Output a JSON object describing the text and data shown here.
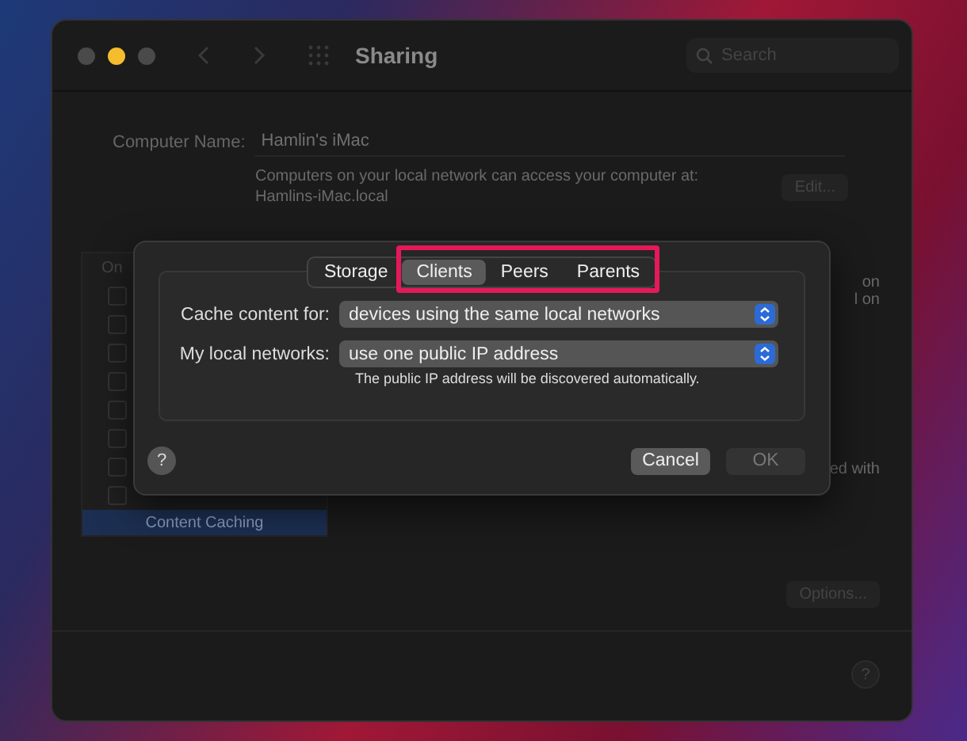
{
  "window": {
    "title": "Sharing",
    "search": {
      "placeholder": "Search"
    }
  },
  "computer_name": {
    "label": "Computer Name:",
    "value": "Hamlin's iMac",
    "note": "Computers on your local network can access your computer at: Hamlins-iMac.local",
    "edit_button": "Edit..."
  },
  "services": {
    "header": "On",
    "checkbox_rows": [
      {
        "checked": false
      },
      {
        "checked": false
      },
      {
        "checked": false
      },
      {
        "checked": false
      },
      {
        "checked": false
      },
      {
        "checked": false
      },
      {
        "checked": false
      },
      {
        "checked": false
      }
    ],
    "selected_row": {
      "label": "Content Caching",
      "selected": true
    }
  },
  "right_fragments": [
    "on",
    "l on",
    "ed with"
  ],
  "options_button": "Options...",
  "help_button": "?",
  "sheet": {
    "tabs": [
      {
        "label": "Storage",
        "selected": false
      },
      {
        "label": "Clients",
        "selected": true
      },
      {
        "label": "Peers",
        "selected": false
      },
      {
        "label": "Parents",
        "selected": false
      }
    ],
    "fields": [
      {
        "label": "Cache content for:",
        "value": "devices using the same local networks"
      },
      {
        "label": "My local networks:",
        "value": "use one public IP address"
      }
    ],
    "note": "The public IP address will be discovered automatically.",
    "help_button": "?",
    "buttons": [
      {
        "label": "Cancel",
        "disabled": false
      },
      {
        "label": "OK",
        "disabled": true
      }
    ]
  }
}
